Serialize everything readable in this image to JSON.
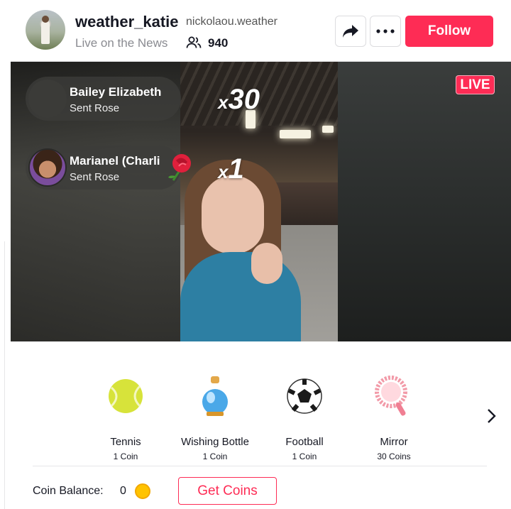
{
  "header": {
    "username": "weather_katie",
    "handle": "nickolaou.weather",
    "subtitle": "Live on the News",
    "viewer_count": "940",
    "follow_label": "Follow"
  },
  "live": {
    "badge": "LIVE",
    "gift_feed": [
      {
        "name": "Bailey Elizabeth",
        "action": "Sent Rose",
        "combo_prefix": "x",
        "combo": "30"
      },
      {
        "name": "Marianel (Charli",
        "action": "Sent Rose",
        "combo_prefix": "x",
        "combo": "1"
      }
    ]
  },
  "gifts": [
    {
      "name": "Tennis",
      "cost": "1 Coin",
      "icon": "tennis-ball-icon"
    },
    {
      "name": "Wishing Bottle",
      "cost": "1 Coin",
      "icon": "wishing-bottle-icon"
    },
    {
      "name": "Football",
      "cost": "1 Coin",
      "icon": "football-icon"
    },
    {
      "name": "Mirror",
      "cost": "30 Coins",
      "icon": "mirror-icon"
    }
  ],
  "wallet": {
    "label": "Coin Balance:",
    "balance": "0",
    "get_coins_label": "Get Coins"
  },
  "colors": {
    "accent": "#fe2c55",
    "coin": "#ffc300"
  }
}
